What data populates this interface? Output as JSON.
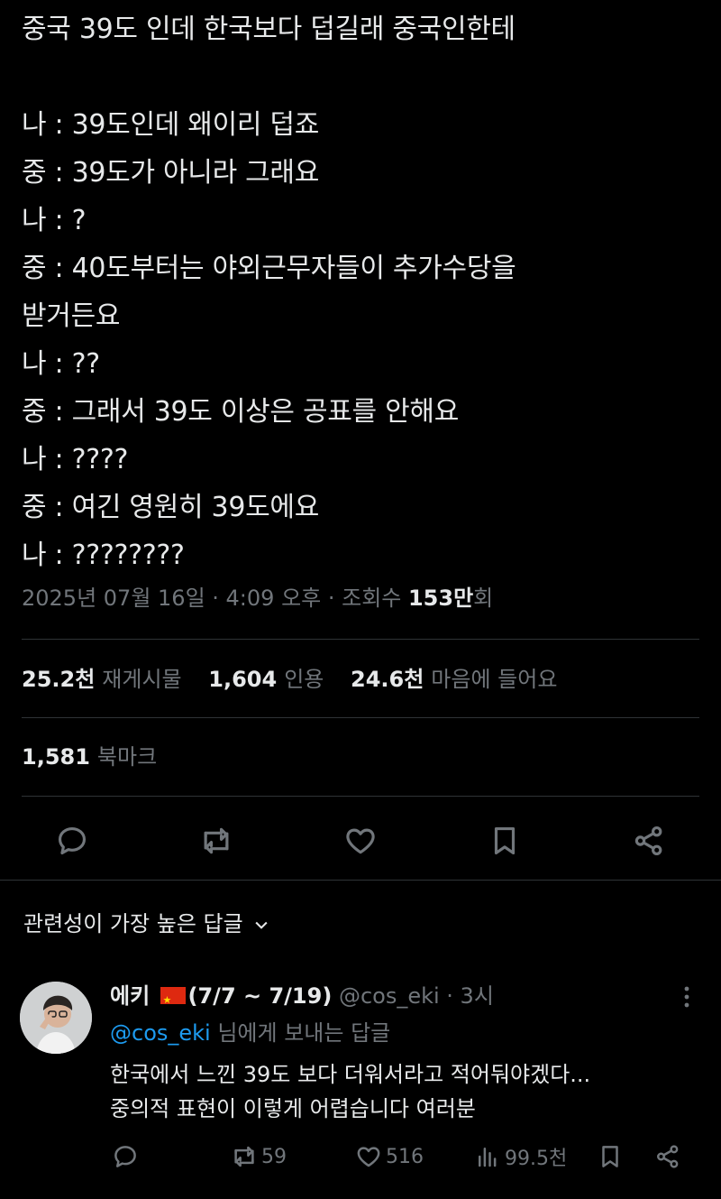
{
  "tweet": {
    "lines": [
      "중국 39도 인데 한국보다 덥길래 중국인한테",
      "",
      "나 : 39도인데 왜이리 덥죠",
      "중 : 39도가 아니라 그래요",
      "나 : ?",
      "중 : 40도부터는 야외근무자들이 추가수당을",
      "받거든요",
      "나 : ??",
      "중 : 그래서 39도 이상은 공표를 안해요",
      "나 : ????",
      "중 : 여긴 영원히 39도에요",
      "나 : ????????"
    ],
    "timestamp": "2025년 07월 16일 · 4:09 오후 · 조회수 ",
    "views_num": "153만",
    "views_unit": "회"
  },
  "stats": {
    "reposts_num": "25.2천",
    "reposts_label": "재게시물",
    "quotes_num": "1,604",
    "quotes_label": "인용",
    "likes_num": "24.6천",
    "likes_label": "마음에 들어요",
    "bookmarks_num": "1,581",
    "bookmarks_label": "북마크"
  },
  "actions": {
    "icons": [
      "reply-icon",
      "retweet-icon",
      "heart-icon",
      "bookmark-icon",
      "share-icon"
    ]
  },
  "replies_sort": {
    "label": "관련성이 가장 높은 답글"
  },
  "reply": {
    "name_prefix": "에키 ",
    "name_suffix": "(7/7 ~ 7/19)",
    "handle_time": " @cos_eki · 3시",
    "replying_mention": "@cos_eki",
    "replying_text": " 님에게 보내는 답글",
    "text": "한국에서 느낀 39도 보다 더워서라고 적어둬야겠다...\n중의적 표현이 이렇게 어렵습니다 여러분",
    "retweets": "59",
    "likes": "516",
    "views": "99.5천"
  },
  "colors": {
    "background": "#000000",
    "text": "#e7e9ea",
    "muted": "#71767b",
    "link": "#1d9bf0",
    "divider": "#2f3336"
  }
}
